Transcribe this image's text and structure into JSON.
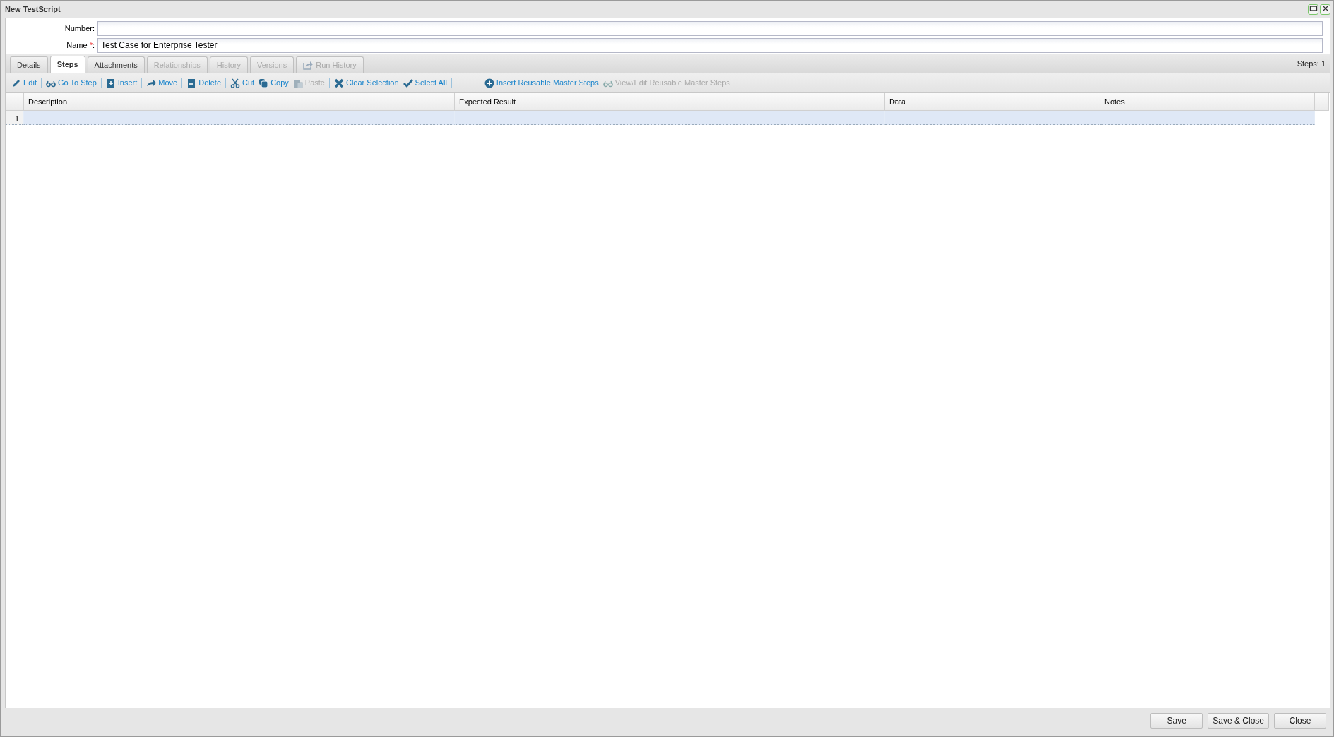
{
  "window": {
    "title": "New TestScript"
  },
  "fields": [
    {
      "label": "Number:"
    },
    {
      "label": "Name",
      "required_mark": "*",
      "colon": ":",
      "value": "Test Case for Enterprise Tester"
    }
  ],
  "tabs": [
    {
      "label": "Details",
      "selected": false,
      "disabled": false
    },
    {
      "label": "Steps",
      "selected": true,
      "disabled": false
    },
    {
      "label": "Attachments",
      "selected": false,
      "disabled": false
    },
    {
      "label": "Relationships",
      "selected": false,
      "disabled": true
    },
    {
      "label": "History",
      "selected": false,
      "disabled": true
    },
    {
      "label": "Versions",
      "selected": false,
      "disabled": true
    },
    {
      "label": "Run History",
      "selected": false,
      "disabled": true
    }
  ],
  "steps_count": "Steps: 1",
  "toolbar": {
    "groups": [
      [
        {
          "label": "Edit",
          "disabled": false
        }
      ],
      [
        {
          "label": "Go To Step",
          "disabled": false
        }
      ],
      [
        {
          "label": "Insert",
          "disabled": false
        }
      ],
      [
        {
          "label": "Move",
          "disabled": false
        }
      ],
      [
        {
          "label": "Delete",
          "disabled": false
        }
      ],
      [
        {
          "label": "Cut",
          "disabled": false
        },
        {
          "label": "Copy",
          "disabled": false
        },
        {
          "label": "Paste",
          "disabled": true
        }
      ],
      [
        {
          "label": "Clear Selection",
          "disabled": false
        },
        {
          "label": "Select All",
          "disabled": false
        }
      ]
    ],
    "right": [
      {
        "label": "Insert Reusable Master Steps",
        "disabled": false
      },
      {
        "label": "View/Edit Reusable Master Steps",
        "disabled": true
      }
    ]
  },
  "table": {
    "columns": [
      "Description",
      "Expected Result",
      "Data",
      "Notes"
    ],
    "rows": [
      {
        "number": "1",
        "selected": true
      }
    ]
  },
  "buttons": [
    "Save",
    "Save & Close",
    "Close"
  ]
}
